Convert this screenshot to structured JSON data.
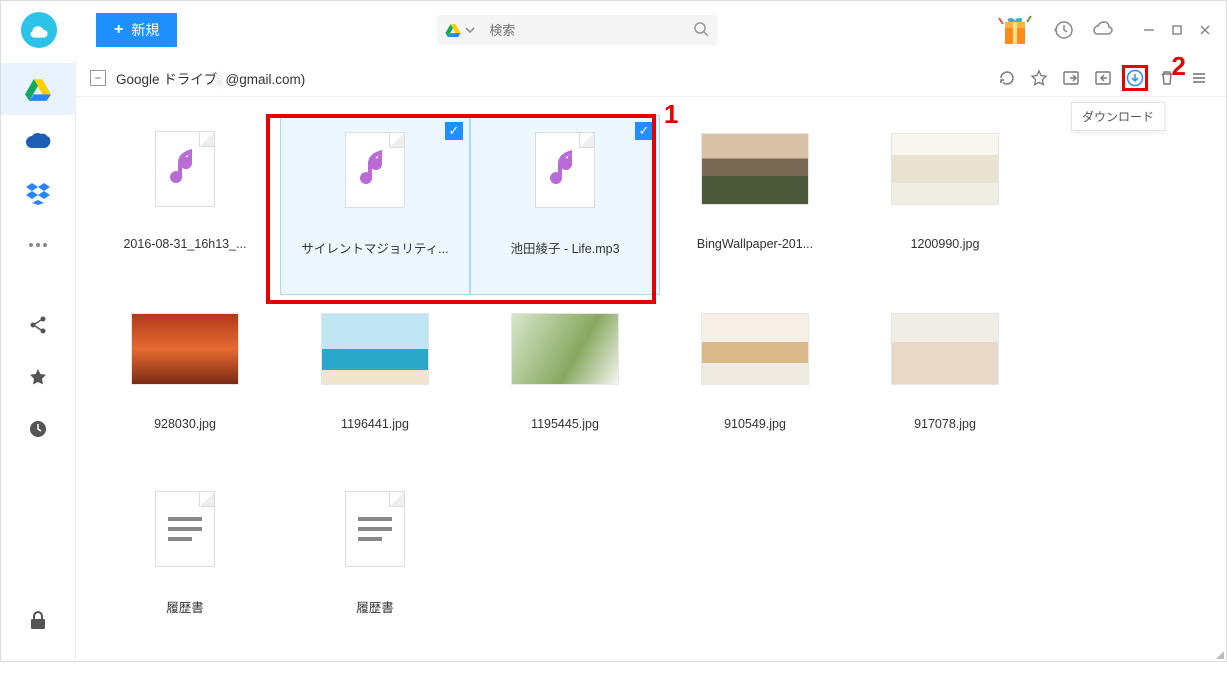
{
  "titlebar": {
    "new_button": "新規",
    "search_placeholder": "検索"
  },
  "breadcrumb": {
    "drive_label": "Google ドライブ",
    "account_suffix": "@gmail.com)",
    "account_masked": "(              "
  },
  "toolbar": {
    "download_tooltip": "ダウンロード"
  },
  "annotations": {
    "label1": "1",
    "label2": "2"
  },
  "files": [
    {
      "name": "2016-08-31_16h13_...",
      "type": "music",
      "selected": false
    },
    {
      "name": "サイレントマジョリティ...",
      "type": "music",
      "selected": true
    },
    {
      "name": "池田綾子 - Life.mp3",
      "type": "music",
      "selected": true
    },
    {
      "name": "BingWallpaper-201...",
      "type": "image",
      "thumb": "img-mountain",
      "selected": false
    },
    {
      "name": "1200990.jpg",
      "type": "image",
      "thumb": "img-window",
      "selected": false
    },
    {
      "name": "928030.jpg",
      "type": "image",
      "thumb": "img-autumn",
      "selected": false
    },
    {
      "name": "1196441.jpg",
      "type": "image",
      "thumb": "img-beach",
      "selected": false
    },
    {
      "name": "1195445.jpg",
      "type": "image",
      "thumb": "img-plants",
      "selected": false
    },
    {
      "name": "910549.jpg",
      "type": "image",
      "thumb": "img-cake",
      "selected": false
    },
    {
      "name": "917078.jpg",
      "type": "image",
      "thumb": "img-photos",
      "selected": false
    },
    {
      "name": "履歴書",
      "type": "doc",
      "selected": false
    },
    {
      "name": "履歴書",
      "type": "doc",
      "selected": false
    }
  ]
}
